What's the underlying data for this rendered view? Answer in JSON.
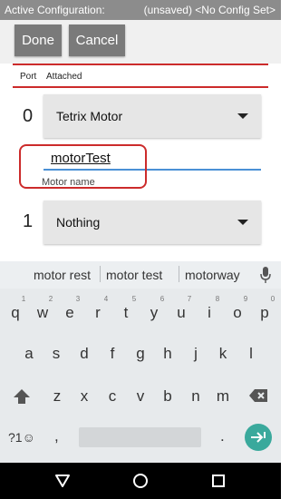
{
  "config_bar": {
    "left_text": "Active Configuration:",
    "right_text": "(unsaved) <No Config Set>"
  },
  "toolbar": {
    "done_label": "Done",
    "cancel_label": "Cancel"
  },
  "table_header": {
    "port": "Port",
    "attached": "Attached"
  },
  "ports": [
    {
      "number": "0",
      "device": "Tetrix Motor"
    },
    {
      "number": "1",
      "device": "Nothing"
    }
  ],
  "motor_name": {
    "value": "motorTest",
    "hint": "Motor name"
  },
  "keyboard": {
    "suggestions": [
      "motor rest",
      "motor test",
      "motorway"
    ],
    "row1": [
      "q",
      "w",
      "e",
      "r",
      "t",
      "y",
      "u",
      "i",
      "o",
      "p"
    ],
    "row1_hints": [
      "1",
      "2",
      "3",
      "4",
      "5",
      "6",
      "7",
      "8",
      "9",
      "0"
    ],
    "row2": [
      "a",
      "s",
      "d",
      "f",
      "g",
      "h",
      "j",
      "k",
      "l"
    ],
    "row3": [
      "z",
      "x",
      "c",
      "v",
      "b",
      "n",
      "m"
    ],
    "symbols_label": "?1☺",
    "comma": ",",
    "period": "."
  },
  "icons": {
    "mic": "mic-icon",
    "shift": "shift-icon",
    "backspace": "backspace-icon",
    "enter": "enter-icon",
    "back": "back-icon",
    "home": "home-icon",
    "recents": "recents-icon"
  },
  "colors": {
    "accent_red": "#cc2b2b",
    "input_blue": "#4a90d6",
    "enter_teal": "#3aa99c"
  }
}
